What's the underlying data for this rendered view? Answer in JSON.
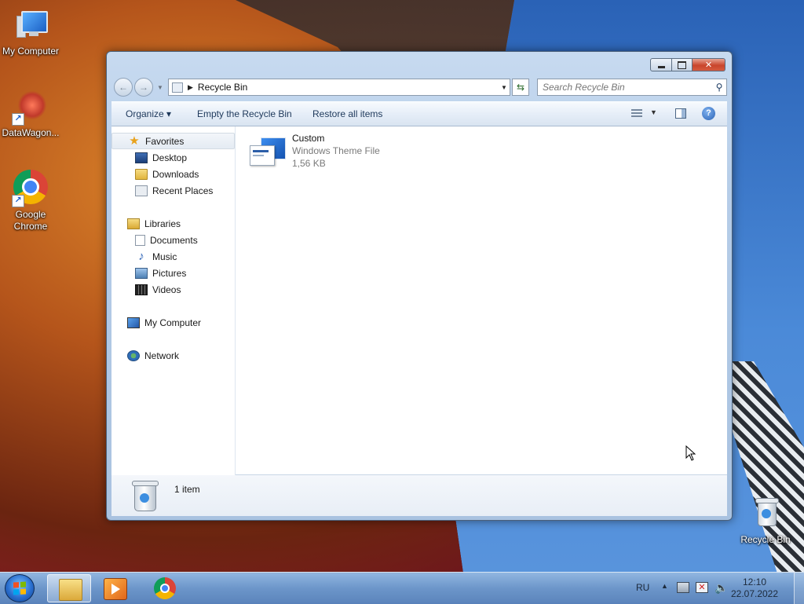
{
  "desktop": {
    "icons": [
      {
        "label": "My Computer"
      },
      {
        "label": "DataWagon..."
      },
      {
        "label": "Google Chrome"
      },
      {
        "label": "Recycle Bin"
      }
    ]
  },
  "window": {
    "address": {
      "crumb": "Recycle Bin"
    },
    "search": {
      "placeholder": "Search Recycle Bin"
    },
    "toolbar": {
      "organize": "Organize",
      "empty": "Empty the Recycle Bin",
      "restore": "Restore all items",
      "organize_arrow": "▾"
    },
    "nav": {
      "favorites": "Favorites",
      "desktop": "Desktop",
      "downloads": "Downloads",
      "recent": "Recent Places",
      "libraries": "Libraries",
      "documents": "Documents",
      "music": "Music",
      "pictures": "Pictures",
      "videos": "Videos",
      "computer": "My Computer",
      "network": "Network"
    },
    "files": [
      {
        "name": "Custom",
        "type": "Windows Theme File",
        "size": "1,56 KB"
      }
    ],
    "details": {
      "count": "1 item"
    }
  },
  "taskbar": {
    "tray": {
      "language": "RU",
      "time": "12:10",
      "date": "22.07.2022"
    }
  },
  "colors": {
    "accent": "#1e395b",
    "window_frame": "#b6cde8",
    "close_button": "#c9452c"
  }
}
